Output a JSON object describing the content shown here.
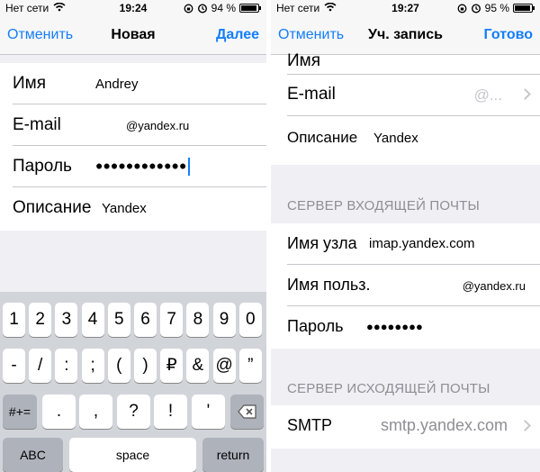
{
  "left": {
    "status": {
      "carrier": "Нет сети",
      "time": "19:24",
      "battery": "94 %",
      "battery_level": 0.94
    },
    "nav": {
      "cancel": "Отменить",
      "title": "Новая",
      "next": "Далее"
    },
    "fields": [
      {
        "label": "Имя",
        "value": "Andrey"
      },
      {
        "label": "E-mail",
        "value": "@yandex.ru"
      },
      {
        "label": "Пароль",
        "value": "●●●●●●●●●●●●"
      },
      {
        "label": "Описание",
        "value": "Yandex"
      }
    ],
    "keyboard": {
      "row1": [
        "1",
        "2",
        "3",
        "4",
        "5",
        "6",
        "7",
        "8",
        "9",
        "0"
      ],
      "row2": [
        "-",
        "/",
        ":",
        ";",
        "(",
        ")",
        "₽",
        "&",
        "@",
        "”"
      ],
      "row3": [
        ".",
        ",",
        "?",
        "!",
        "'"
      ],
      "symbols_key": "#+=",
      "abc_key": "ABC",
      "space_key": "space",
      "return_key": "return",
      "backspace_icon": "backspace-icon"
    }
  },
  "right": {
    "status": {
      "carrier": "Нет сети",
      "time": "19:27",
      "battery": "95 %",
      "battery_level": 0.95
    },
    "nav": {
      "cancel": "Отменить",
      "title": "Уч. запись",
      "done": "Готово"
    },
    "account_rows": [
      {
        "label": "Имя",
        "value": ""
      },
      {
        "label": "E-mail",
        "value": "@..."
      },
      {
        "label": "Описание",
        "value": "Yandex"
      }
    ],
    "incoming_header": "СЕРВЕР ВХОДЯЩЕЙ ПОЧТЫ",
    "incoming_rows": [
      {
        "label": "Имя узла",
        "value": "imap.yandex.com"
      },
      {
        "label": "Имя польз.",
        "value": "@yandex.ru"
      },
      {
        "label": "Пароль",
        "value": "●●●●●●●●"
      }
    ],
    "outgoing_header": "СЕРВЕР ИСХОДЯЩЕЙ ПОЧТЫ",
    "outgoing_rows": [
      {
        "label": "SMTP",
        "value": "smtp.yandex.com"
      }
    ]
  },
  "colors": {
    "accent": "#147efb",
    "background": "#efeff4",
    "separator": "#c8c7cc",
    "keyboard": "#d1d4d9"
  }
}
